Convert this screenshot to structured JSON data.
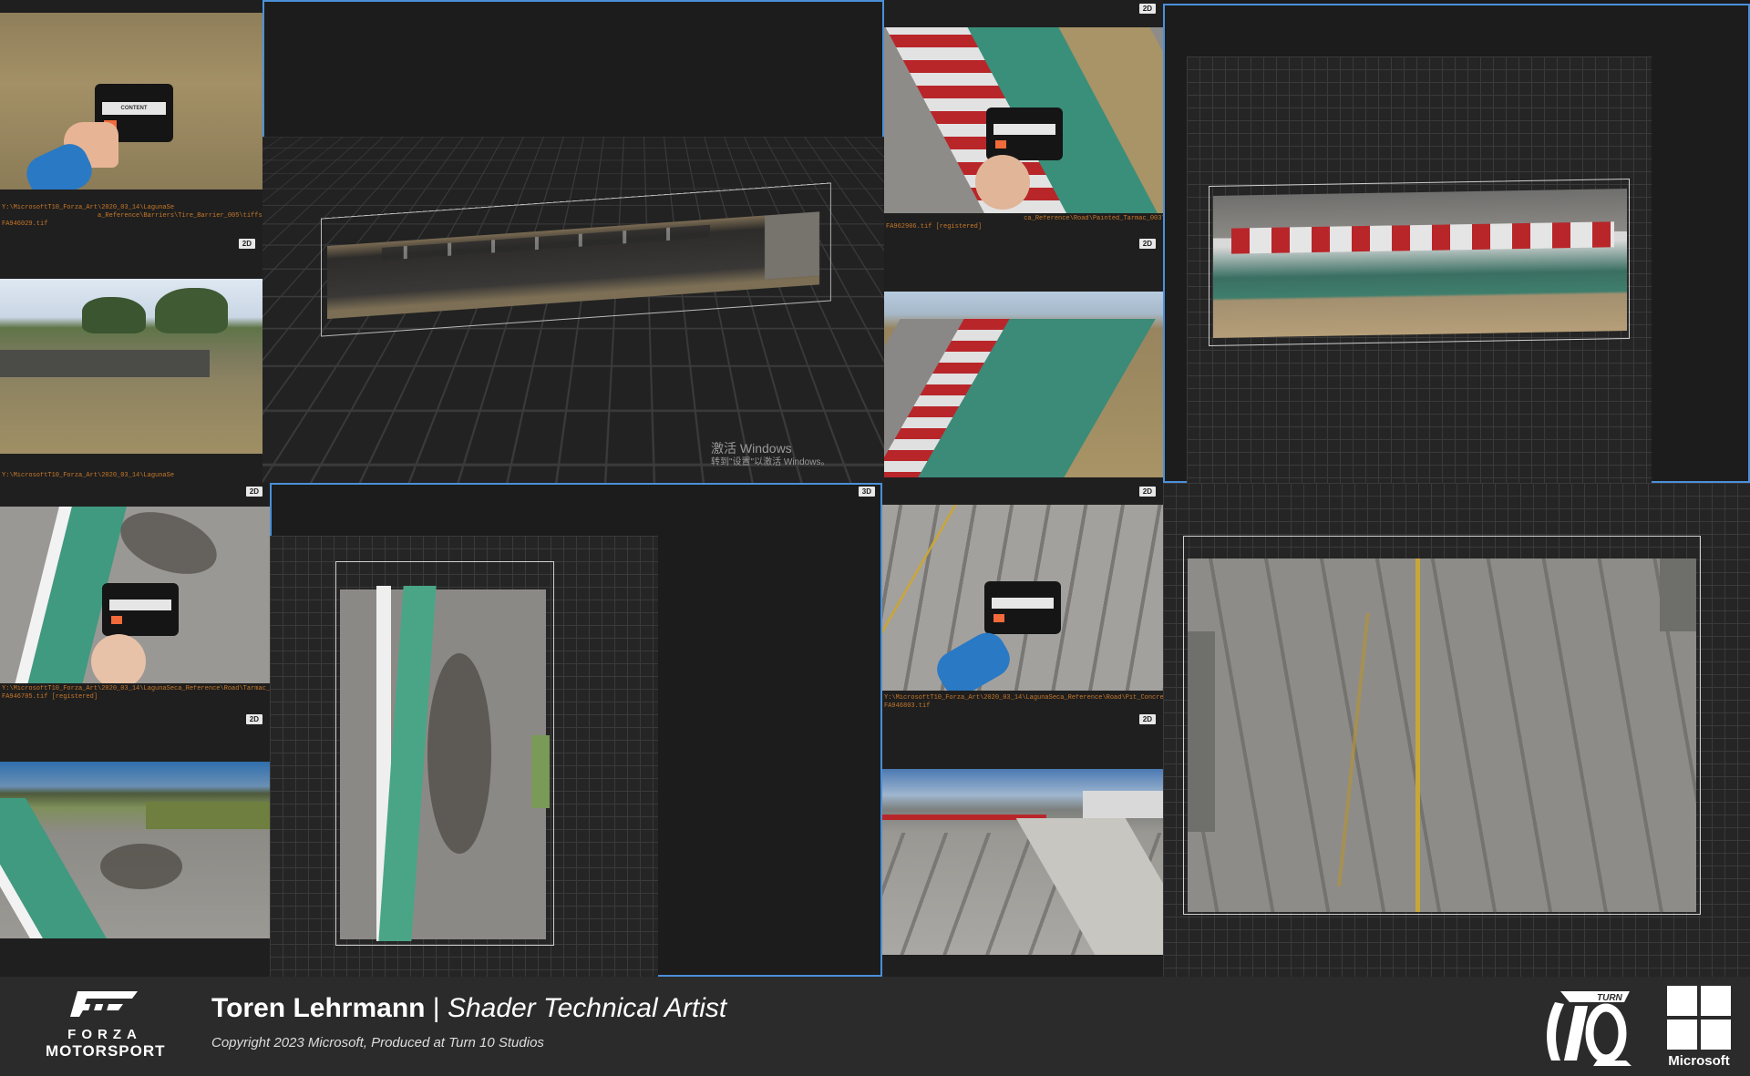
{
  "panels": {
    "p1": {
      "path": "Y:\\MicrosoftT10_Forza_Art\\2020_03_14\\LagunaSe\n                         a_Reference\\Barriers\\Tire_Barrier_005\\tiffs\\\nFA946029.tif"
    },
    "p2": {
      "badge": "2D",
      "path": "Y:\\MicrosoftT10_Forza_Art\\2020_03_14\\LagunaSe"
    },
    "p5": {
      "badge": "2D"
    },
    "p6": {
      "badge": "2D",
      "path": "                                    ca_Reference\\Road\\Painted_Tarmac_003\\tiffs\\\nFA962906.tif [registered]"
    },
    "p7": {
      "badge": "2D"
    },
    "p9": {
      "badge": "2D",
      "path": "Y:\\MicrosoftT10_Forza_Art\\2020_03_14\\LagunaSeca_Reference\\Road\\Tarmac_009\\tiffs\\\nFA946705.tif [registered]"
    },
    "p10": {
      "badge": "2D"
    },
    "p11": {
      "badge": "3D"
    },
    "p12": {
      "badge": "2D",
      "path": "Y:\\MicrosoftT10_Forza_Art\\2020_03_14\\LagunaSeca_Reference\\Road\\Pit_Concrete_001\\tiffs\\\nFA946803.tif"
    },
    "p13": {
      "badge": "2D"
    }
  },
  "watermark": {
    "line1": "激活 Windows",
    "line2": "转到\"设置\"以激活 Windows。"
  },
  "card_label": "CONTENT",
  "footer": {
    "brand_word": "FORZA",
    "brand_sub": "MOTORSPORT",
    "name": "Toren Lehrmann",
    "separator": " | ",
    "role": "Shader Technical Artist",
    "copyright": "Copyright 2023 Microsoft, Produced at Turn 10 Studios",
    "turn_word": "TURN",
    "turn_num": "10",
    "microsoft": "Microsoft"
  },
  "colors": {
    "selection": "#4a90d9",
    "path_text": "#c7782a",
    "footer_bg": "#2b2b2b",
    "curb_red": "#b8262a",
    "curb_green": "#3a8f7a"
  }
}
